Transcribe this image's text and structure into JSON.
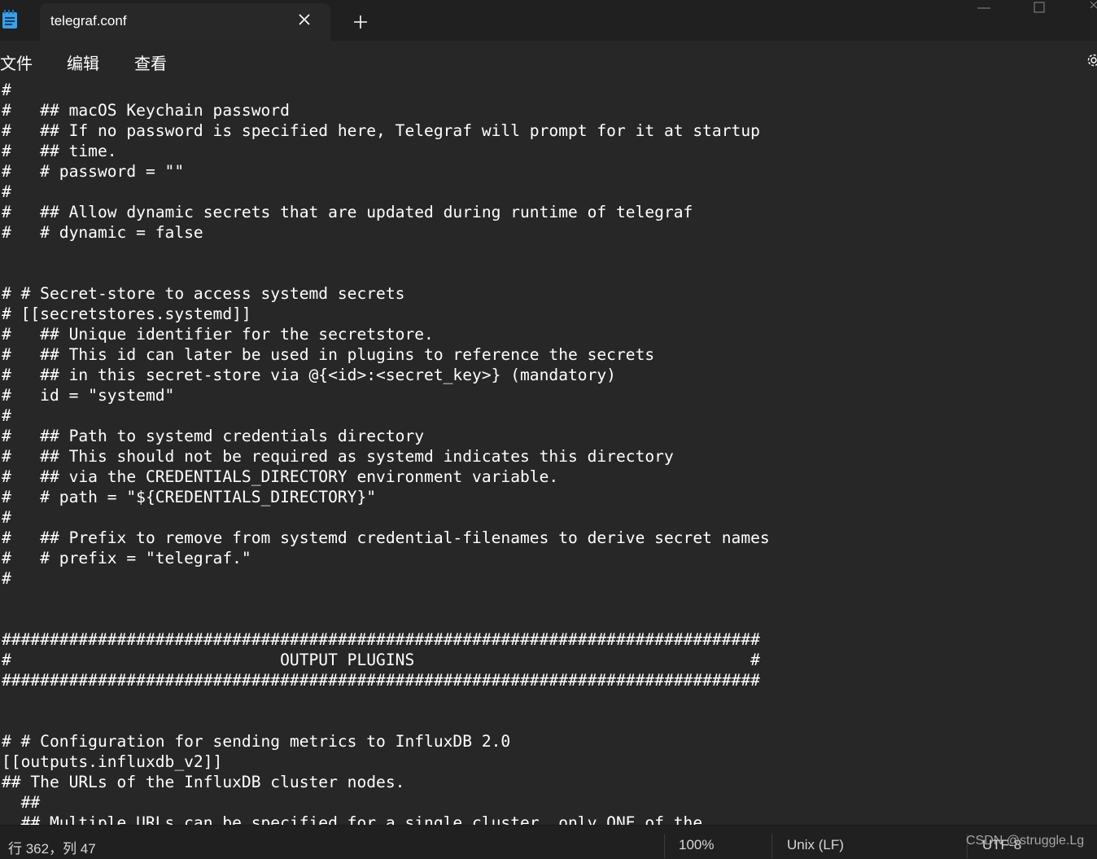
{
  "tab": {
    "title": "telegraf.conf"
  },
  "menu": {
    "file": "文件",
    "edit": "编辑",
    "view": "查看"
  },
  "editor": {
    "lines": [
      "#",
      "#   ## macOS Keychain password",
      "#   ## If no password is specified here, Telegraf will prompt for it at startup",
      "#   ## time.",
      "#   # password = \"\"",
      "#",
      "#   ## Allow dynamic secrets that are updated during runtime of telegraf",
      "#   # dynamic = false",
      "",
      "",
      "# # Secret-store to access systemd secrets",
      "# [[secretstores.systemd]]",
      "#   ## Unique identifier for the secretstore.",
      "#   ## This id can later be used in plugins to reference the secrets",
      "#   ## in this secret-store via @{<id>:<secret_key>} (mandatory)",
      "#   id = \"systemd\"",
      "#",
      "#   ## Path to systemd credentials directory",
      "#   ## This should not be required as systemd indicates this directory",
      "#   ## via the CREDENTIALS_DIRECTORY environment variable.",
      "#   # path = \"${CREDENTIALS_DIRECTORY}\"",
      "#",
      "#   ## Prefix to remove from systemd credential-filenames to derive secret names",
      "#   # prefix = \"telegraf.\"",
      "#",
      "",
      "",
      "###############################################################################",
      "#                            OUTPUT PLUGINS                                   #",
      "###############################################################################",
      "",
      "",
      "# # Configuration for sending metrics to InfluxDB 2.0",
      "[[outputs.influxdb_v2]]",
      "## The URLs of the InfluxDB cluster nodes.",
      "  ##",
      "  ## Multiple URLs can be specified for a single cluster, only ONE of the"
    ]
  },
  "status": {
    "position": "行 362，列 47",
    "zoom": "100%",
    "line_ending": "Unix (LF)",
    "encoding": "UTF-8"
  },
  "watermark": "CSDN @struggle.Lg"
}
